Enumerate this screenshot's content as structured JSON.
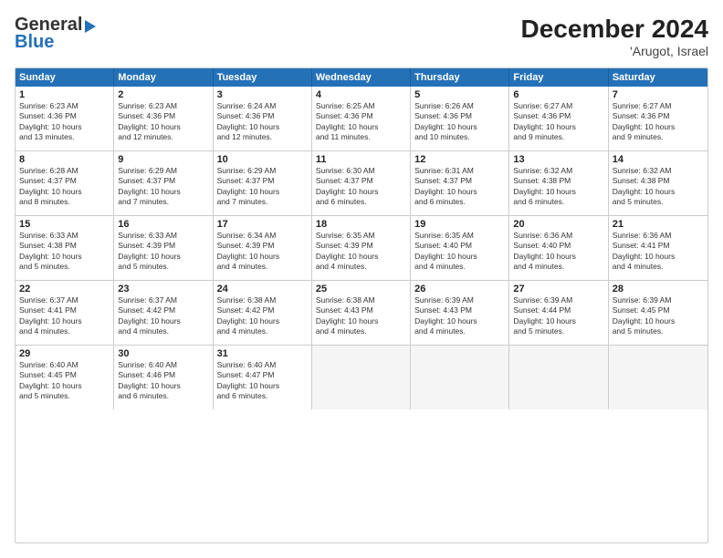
{
  "logo": {
    "line1": "General",
    "line2": "Blue"
  },
  "title": "December 2024",
  "subtitle": "'Arugot, Israel",
  "header_days": [
    "Sunday",
    "Monday",
    "Tuesday",
    "Wednesday",
    "Thursday",
    "Friday",
    "Saturday"
  ],
  "weeks": [
    [
      {
        "day": "1",
        "info": "Sunrise: 6:23 AM\nSunset: 4:36 PM\nDaylight: 10 hours\nand 13 minutes."
      },
      {
        "day": "2",
        "info": "Sunrise: 6:23 AM\nSunset: 4:36 PM\nDaylight: 10 hours\nand 12 minutes."
      },
      {
        "day": "3",
        "info": "Sunrise: 6:24 AM\nSunset: 4:36 PM\nDaylight: 10 hours\nand 12 minutes."
      },
      {
        "day": "4",
        "info": "Sunrise: 6:25 AM\nSunset: 4:36 PM\nDaylight: 10 hours\nand 11 minutes."
      },
      {
        "day": "5",
        "info": "Sunrise: 6:26 AM\nSunset: 4:36 PM\nDaylight: 10 hours\nand 10 minutes."
      },
      {
        "day": "6",
        "info": "Sunrise: 6:27 AM\nSunset: 4:36 PM\nDaylight: 10 hours\nand 9 minutes."
      },
      {
        "day": "7",
        "info": "Sunrise: 6:27 AM\nSunset: 4:36 PM\nDaylight: 10 hours\nand 9 minutes."
      }
    ],
    [
      {
        "day": "8",
        "info": "Sunrise: 6:28 AM\nSunset: 4:37 PM\nDaylight: 10 hours\nand 8 minutes."
      },
      {
        "day": "9",
        "info": "Sunrise: 6:29 AM\nSunset: 4:37 PM\nDaylight: 10 hours\nand 7 minutes."
      },
      {
        "day": "10",
        "info": "Sunrise: 6:29 AM\nSunset: 4:37 PM\nDaylight: 10 hours\nand 7 minutes."
      },
      {
        "day": "11",
        "info": "Sunrise: 6:30 AM\nSunset: 4:37 PM\nDaylight: 10 hours\nand 6 minutes."
      },
      {
        "day": "12",
        "info": "Sunrise: 6:31 AM\nSunset: 4:37 PM\nDaylight: 10 hours\nand 6 minutes."
      },
      {
        "day": "13",
        "info": "Sunrise: 6:32 AM\nSunset: 4:38 PM\nDaylight: 10 hours\nand 6 minutes."
      },
      {
        "day": "14",
        "info": "Sunrise: 6:32 AM\nSunset: 4:38 PM\nDaylight: 10 hours\nand 5 minutes."
      }
    ],
    [
      {
        "day": "15",
        "info": "Sunrise: 6:33 AM\nSunset: 4:38 PM\nDaylight: 10 hours\nand 5 minutes."
      },
      {
        "day": "16",
        "info": "Sunrise: 6:33 AM\nSunset: 4:39 PM\nDaylight: 10 hours\nand 5 minutes."
      },
      {
        "day": "17",
        "info": "Sunrise: 6:34 AM\nSunset: 4:39 PM\nDaylight: 10 hours\nand 4 minutes."
      },
      {
        "day": "18",
        "info": "Sunrise: 6:35 AM\nSunset: 4:39 PM\nDaylight: 10 hours\nand 4 minutes."
      },
      {
        "day": "19",
        "info": "Sunrise: 6:35 AM\nSunset: 4:40 PM\nDaylight: 10 hours\nand 4 minutes."
      },
      {
        "day": "20",
        "info": "Sunrise: 6:36 AM\nSunset: 4:40 PM\nDaylight: 10 hours\nand 4 minutes."
      },
      {
        "day": "21",
        "info": "Sunrise: 6:36 AM\nSunset: 4:41 PM\nDaylight: 10 hours\nand 4 minutes."
      }
    ],
    [
      {
        "day": "22",
        "info": "Sunrise: 6:37 AM\nSunset: 4:41 PM\nDaylight: 10 hours\nand 4 minutes."
      },
      {
        "day": "23",
        "info": "Sunrise: 6:37 AM\nSunset: 4:42 PM\nDaylight: 10 hours\nand 4 minutes."
      },
      {
        "day": "24",
        "info": "Sunrise: 6:38 AM\nSunset: 4:42 PM\nDaylight: 10 hours\nand 4 minutes."
      },
      {
        "day": "25",
        "info": "Sunrise: 6:38 AM\nSunset: 4:43 PM\nDaylight: 10 hours\nand 4 minutes."
      },
      {
        "day": "26",
        "info": "Sunrise: 6:39 AM\nSunset: 4:43 PM\nDaylight: 10 hours\nand 4 minutes."
      },
      {
        "day": "27",
        "info": "Sunrise: 6:39 AM\nSunset: 4:44 PM\nDaylight: 10 hours\nand 5 minutes."
      },
      {
        "day": "28",
        "info": "Sunrise: 6:39 AM\nSunset: 4:45 PM\nDaylight: 10 hours\nand 5 minutes."
      }
    ],
    [
      {
        "day": "29",
        "info": "Sunrise: 6:40 AM\nSunset: 4:45 PM\nDaylight: 10 hours\nand 5 minutes."
      },
      {
        "day": "30",
        "info": "Sunrise: 6:40 AM\nSunset: 4:46 PM\nDaylight: 10 hours\nand 6 minutes."
      },
      {
        "day": "31",
        "info": "Sunrise: 6:40 AM\nSunset: 4:47 PM\nDaylight: 10 hours\nand 6 minutes."
      },
      {
        "day": "",
        "info": ""
      },
      {
        "day": "",
        "info": ""
      },
      {
        "day": "",
        "info": ""
      },
      {
        "day": "",
        "info": ""
      }
    ]
  ]
}
